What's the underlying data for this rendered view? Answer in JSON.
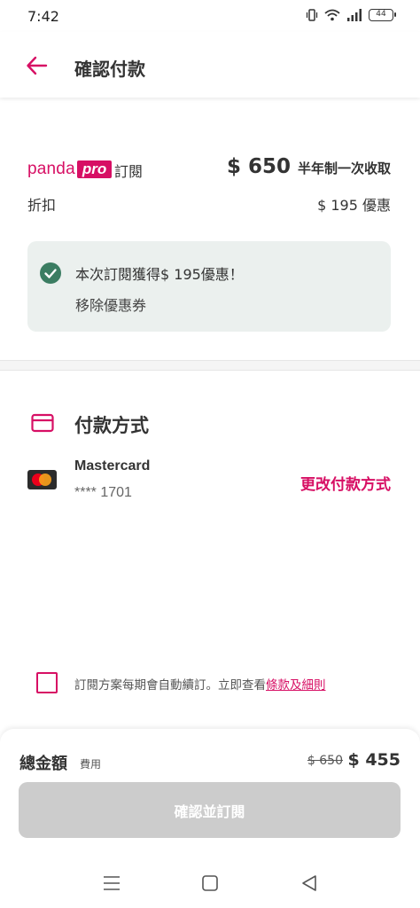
{
  "status_bar": {
    "time": "7:42",
    "battery": "44"
  },
  "header": {
    "title": "確認付款"
  },
  "plan": {
    "brand_panda": "panda",
    "brand_pro": "pro",
    "label": "訂閱",
    "price": "$ 650",
    "price_note": "半年制一次收取"
  },
  "discount": {
    "label": "折扣",
    "value": "$ 195 優惠"
  },
  "voucher": {
    "title": "本次訂閱獲得$ 195優惠！",
    "remove_label": "移除優惠券"
  },
  "payment": {
    "title": "付款方式",
    "card_name": "Mastercard",
    "card_number": "**** 1701",
    "change_label": "更改付款方式"
  },
  "terms": {
    "text": "訂閱方案每期會自動續訂。立即查看",
    "link": "條款及細則",
    "checked": false
  },
  "footer": {
    "total_label": "總金額",
    "total_sub": "費用",
    "old_price": "$ 650",
    "new_price": "$ 455",
    "confirm_label": "確認並訂閱"
  },
  "colors": {
    "brand": "#d70f64",
    "voucher_bg": "#ebf0ee",
    "check_green": "#3b7d62",
    "button_disabled": "#cccccc"
  }
}
